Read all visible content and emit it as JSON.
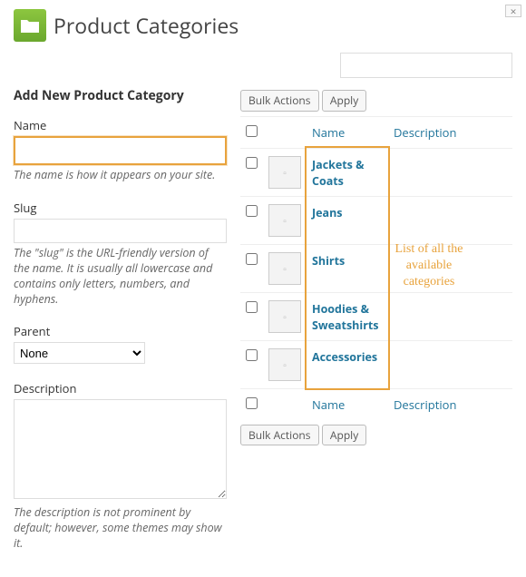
{
  "page_title": "Product Categories",
  "section_title": "Add New Product Category",
  "form": {
    "name": {
      "label": "Name",
      "value": "",
      "description": "The name is how it appears on your site."
    },
    "slug": {
      "label": "Slug",
      "value": "",
      "description": "The \"slug\" is the URL-friendly version of the name. It is usually all lowercase and contains only letters, numbers, and hyphens."
    },
    "parent": {
      "label": "Parent",
      "value": "None"
    },
    "description_field": {
      "label": "Description",
      "value": "",
      "description": "The description is not prominent by default; however, some themes may show it."
    }
  },
  "bulk_actions": {
    "dropdown": "Bulk Actions",
    "apply": "Apply"
  },
  "table_headers": {
    "name": "Name",
    "description": "Description"
  },
  "categories": [
    {
      "name": "Jackets & Coats"
    },
    {
      "name": "Jeans"
    },
    {
      "name": "Shirts"
    },
    {
      "name": "Hoodies & Sweatshirts"
    },
    {
      "name": "Accessories"
    }
  ],
  "annotation_text": "List of all the available categories"
}
